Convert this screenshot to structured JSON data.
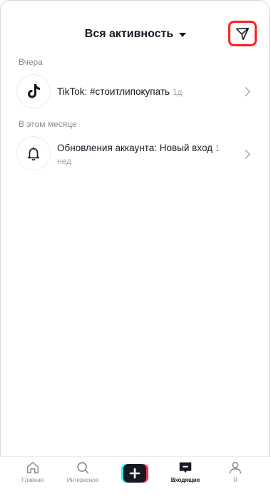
{
  "header": {
    "title": "Вся активность"
  },
  "sections": [
    {
      "label": "Вчера",
      "items": [
        {
          "name": "TikTok:",
          "text": "#стоитлипокупать",
          "time": "1д"
        }
      ]
    },
    {
      "label": "В этом месяце",
      "items": [
        {
          "name": "Обновления аккаунта:",
          "text": "Новый вход",
          "time": "1 нед"
        }
      ]
    }
  ],
  "tabbar": {
    "home": "Главная",
    "discover": "Интересное",
    "inbox": "Входящие",
    "profile": "Я"
  },
  "colors": {
    "highlight": "#ff1f1f",
    "text": "#161823",
    "muted": "#8a8b91"
  }
}
